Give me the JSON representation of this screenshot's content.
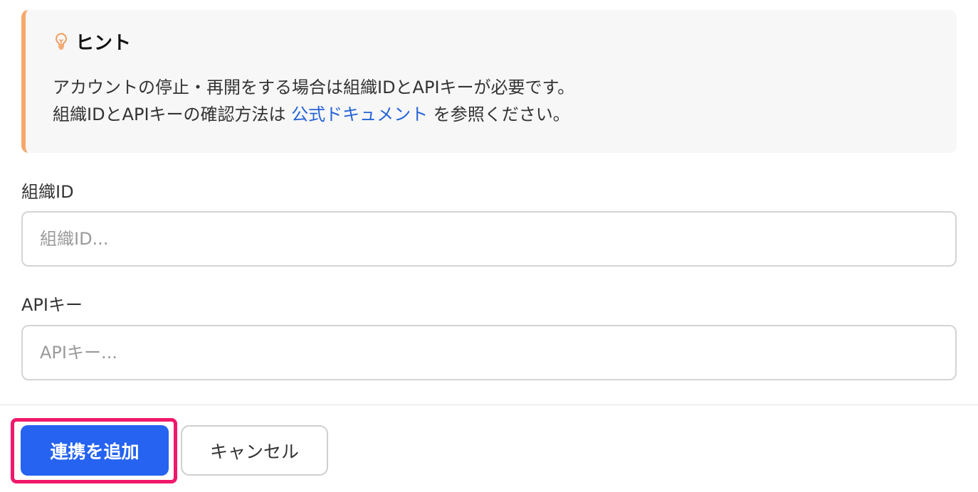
{
  "hint": {
    "title": "ヒント",
    "icon": "lightbulb-icon",
    "accent_color": "#f7a86b",
    "line1": "アカウントの停止・再開をする場合は組織IDとAPIキーが必要です。",
    "line2_prefix": "組織IDとAPIキーの確認方法は ",
    "line2_link": "公式ドキュメント",
    "line2_suffix": " を参照ください。"
  },
  "form": {
    "org_id": {
      "label": "組織ID",
      "placeholder": "組織ID...",
      "value": ""
    },
    "api_key": {
      "label": "APIキー",
      "placeholder": "APIキー...",
      "value": ""
    }
  },
  "actions": {
    "add_label": "連携を追加",
    "cancel_label": "キャンセル",
    "primary_color": "#2563f0",
    "highlight_color": "#f0186a"
  }
}
